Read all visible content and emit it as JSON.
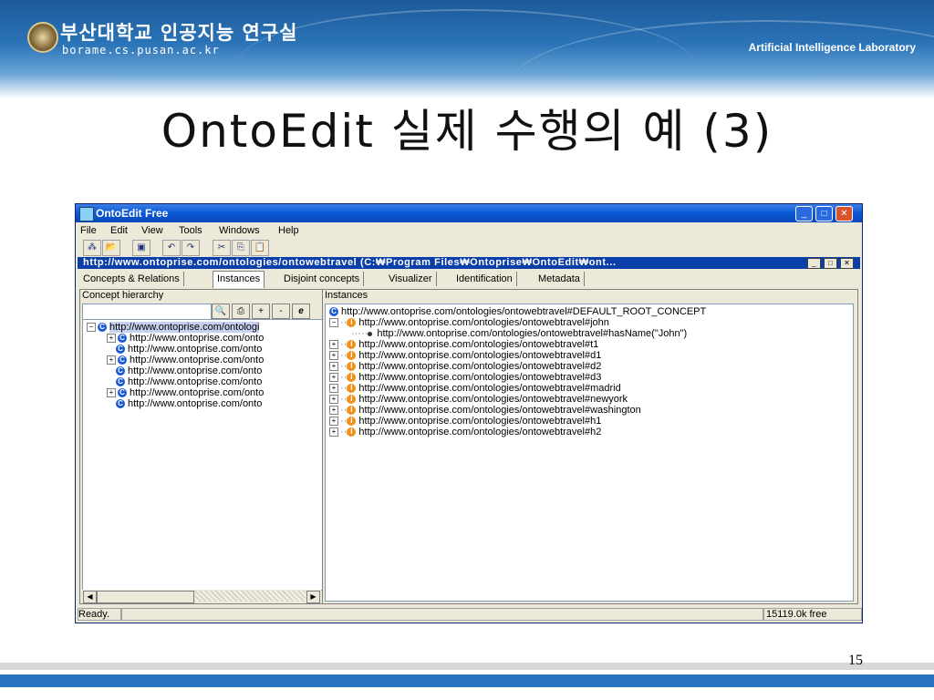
{
  "slide": {
    "org_name": "부산대학교 인공지능 연구실",
    "org_url": "borame.cs.pusan.ac.kr",
    "lab_name": "Artificial Intelligence Laboratory",
    "title": "OntoEdit 실제 수행의 예 (3)",
    "page_number": "15"
  },
  "window": {
    "title": "OntoEdit Free",
    "controls": {
      "minimize": "_",
      "maximize": "□",
      "close": "✕"
    }
  },
  "menu": [
    "File",
    "Edit",
    "View",
    "Tools",
    "Windows",
    "Help"
  ],
  "toolbar": {
    "buttons": [
      {
        "name": "new-ontology-icon",
        "glyph": "⁂"
      },
      {
        "name": "open-icon",
        "glyph": "📂"
      },
      {
        "name": "save-icon",
        "glyph": "▣"
      },
      {
        "name": "undo-icon",
        "glyph": "↶"
      },
      {
        "name": "redo-icon",
        "glyph": "↷"
      },
      {
        "name": "cut-icon",
        "glyph": "✂"
      },
      {
        "name": "copy-icon",
        "glyph": "⎘"
      },
      {
        "name": "paste-icon",
        "glyph": "📋"
      }
    ]
  },
  "document": {
    "title": "http://www.ontoprise.com/ontologies/ontowebtravel (C:₩Program Files₩Ontoprise₩OntoEdit₩ont..."
  },
  "tabs": [
    "Concepts & Relations",
    "Instances",
    "Disjoint concepts",
    "Visualizer",
    "Identification",
    "Metadata"
  ],
  "active_tab": "Instances",
  "concept_panel": {
    "header": "Concept hierarchy",
    "search_value": "",
    "buttons": {
      "search": "🔍",
      "print": "⎙",
      "add": "+",
      "remove": "-",
      "refresh": "e"
    },
    "tree": [
      {
        "label": "http://www.ontoprise.com/ontologi",
        "expander": "−",
        "selected": true
      },
      {
        "label": "http://www.ontoprise.com/onto",
        "expander": "+"
      },
      {
        "label": "http://www.ontoprise.com/onto",
        "expander": ""
      },
      {
        "label": "http://www.ontoprise.com/onto",
        "expander": "+"
      },
      {
        "label": "http://www.ontoprise.com/onto",
        "expander": ""
      },
      {
        "label": "http://www.ontoprise.com/onto",
        "expander": ""
      },
      {
        "label": "http://www.ontoprise.com/onto",
        "expander": "+"
      },
      {
        "label": "http://www.ontoprise.com/onto",
        "expander": ""
      }
    ]
  },
  "instance_panel": {
    "header": "Instances",
    "root": "http://www.ontoprise.com/ontologies/ontowebtravel#DEFAULT_ROOT_CONCEPT",
    "instances": [
      {
        "label": "http://www.ontoprise.com/ontologies/ontowebtravel#john",
        "expander": "−"
      },
      {
        "label": "http://www.ontoprise.com/ontologies/ontowebtravel#hasName(\"John\")",
        "property": true
      },
      {
        "label": "http://www.ontoprise.com/ontologies/ontowebtravel#t1",
        "expander": "+"
      },
      {
        "label": "http://www.ontoprise.com/ontologies/ontowebtravel#d1",
        "expander": "+"
      },
      {
        "label": "http://www.ontoprise.com/ontologies/ontowebtravel#d2",
        "expander": "+"
      },
      {
        "label": "http://www.ontoprise.com/ontologies/ontowebtravel#d3",
        "expander": "+"
      },
      {
        "label": "http://www.ontoprise.com/ontologies/ontowebtravel#madrid",
        "expander": "+"
      },
      {
        "label": "http://www.ontoprise.com/ontologies/ontowebtravel#newyork",
        "expander": "+"
      },
      {
        "label": "http://www.ontoprise.com/ontologies/ontowebtravel#washington",
        "expander": "+"
      },
      {
        "label": "http://www.ontoprise.com/ontologies/ontowebtravel#h1",
        "expander": "+"
      },
      {
        "label": "http://www.ontoprise.com/ontologies/ontowebtravel#h2",
        "expander": "+"
      }
    ]
  },
  "status": {
    "left": "Ready.",
    "right": "15119.0k free"
  },
  "colors": {
    "titlebar": "#0a58d6",
    "docbar": "#0a3ea8",
    "window_bg": "#ece9d8",
    "banner": "#2b74b8",
    "footer": "#2a72c2"
  }
}
